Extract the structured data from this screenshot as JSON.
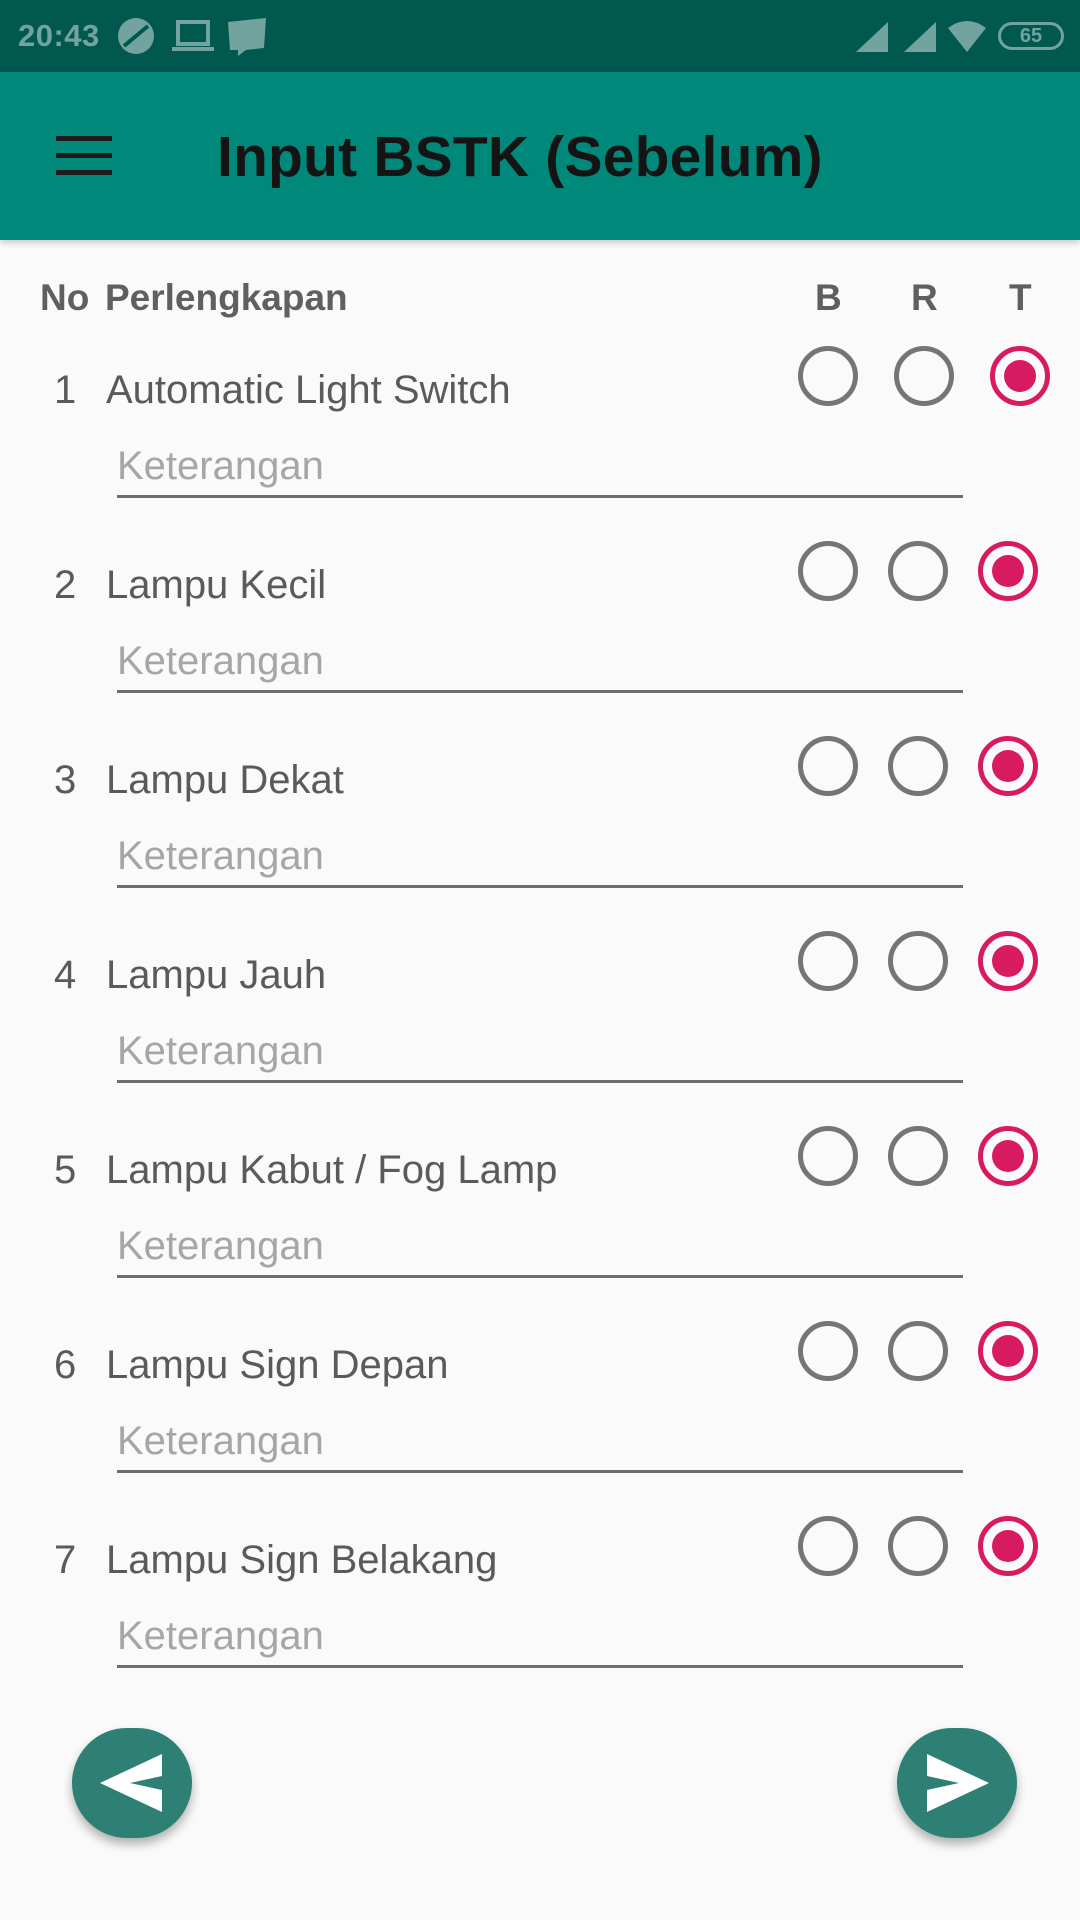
{
  "status_bar": {
    "time": "20:43",
    "battery": "65",
    "left_icons": [
      "sync-icon",
      "laptop-icon",
      "webtoon-icon"
    ],
    "right_icons": [
      "signal-icon",
      "signal-icon",
      "wifi-icon",
      "battery-icon"
    ]
  },
  "toolbar": {
    "title": "Input BSTK (Sebelum)",
    "menu_icon": "menu-icon"
  },
  "header": {
    "no_label": "No",
    "item_label": "Perlengkapan",
    "col_b": "B",
    "col_r": "R",
    "col_t": "T"
  },
  "rows": [
    {
      "no": "1",
      "name": "Automatic Light Switch",
      "selected": "T",
      "placeholder": "Keterangan"
    },
    {
      "no": "2",
      "name": "Lampu Kecil",
      "selected": "T",
      "placeholder": "Keterangan"
    },
    {
      "no": "3",
      "name": "Lampu Dekat",
      "selected": "T",
      "placeholder": "Keterangan"
    },
    {
      "no": "4",
      "name": "Lampu Jauh",
      "selected": "T",
      "placeholder": "Keterangan"
    },
    {
      "no": "5",
      "name": "Lampu Kabut / Fog Lamp",
      "selected": "T",
      "placeholder": "Keterangan"
    },
    {
      "no": "6",
      "name": "Lampu Sign Depan",
      "selected": "T",
      "placeholder": "Keterangan"
    },
    {
      "no": "7",
      "name": "Lampu Sign Belakang",
      "selected": "T",
      "placeholder": "Keterangan"
    }
  ],
  "colors": {
    "primary": "#00897b",
    "primary_dark": "#00584f",
    "accent": "#d81b60",
    "fab": "#2e8075"
  },
  "fabs": {
    "back_icon": "send-back-icon",
    "next_icon": "send-icon"
  }
}
